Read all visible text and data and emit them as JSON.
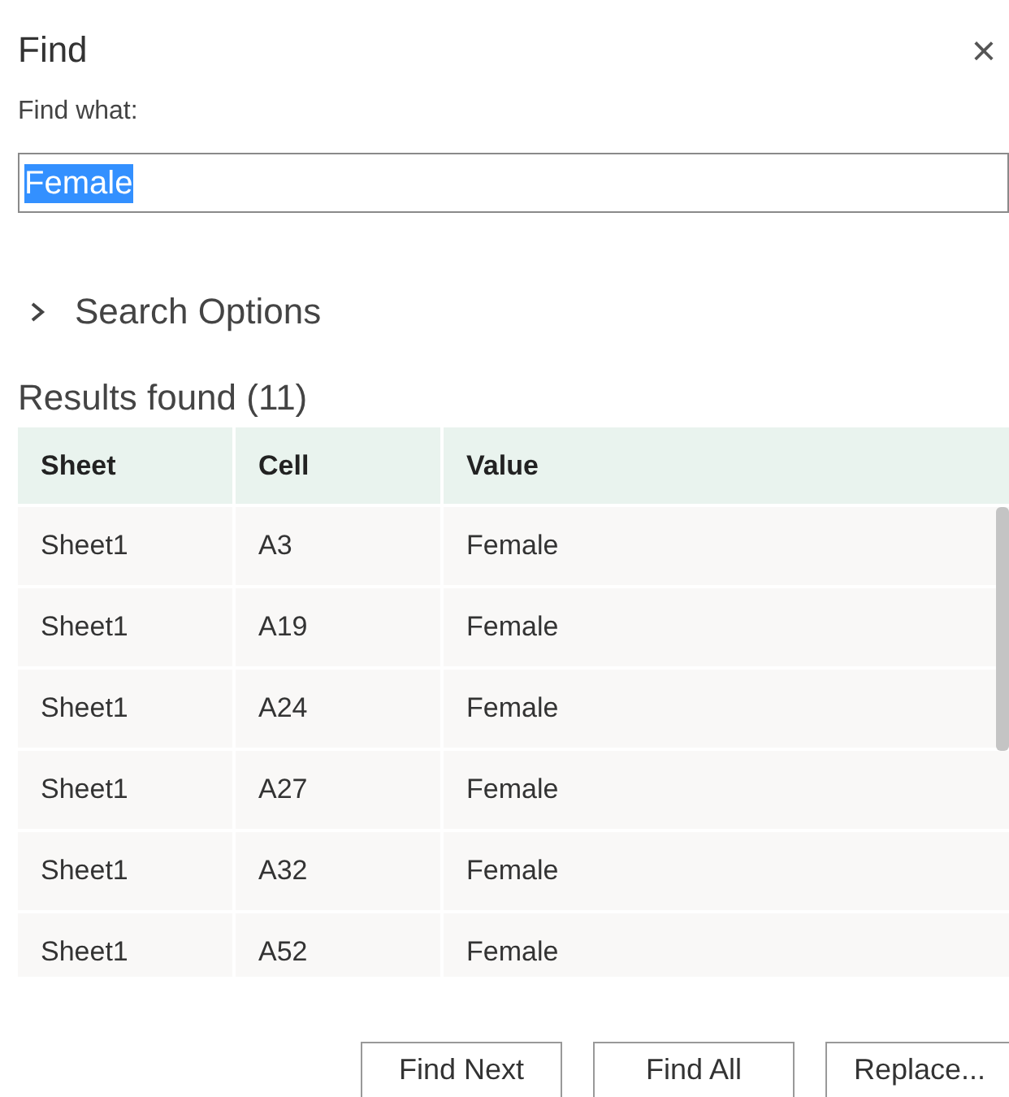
{
  "dialog": {
    "title": "Find",
    "close": "×"
  },
  "find_what": {
    "label": "Find what:",
    "value": "Female",
    "value_selected": true
  },
  "search_options": {
    "label": "Search Options",
    "expanded": false
  },
  "results": {
    "label": "Results found (11)",
    "columns": [
      "Sheet",
      "Cell",
      "Value"
    ],
    "rows": [
      [
        "Sheet1",
        "A3",
        "Female"
      ],
      [
        "Sheet1",
        "A19",
        "Female"
      ],
      [
        "Sheet1",
        "A24",
        "Female"
      ],
      [
        "Sheet1",
        "A27",
        "Female"
      ],
      [
        "Sheet1",
        "A32",
        "Female"
      ],
      [
        "Sheet1",
        "A52",
        "Female"
      ]
    ]
  },
  "buttons": [
    "Find Next",
    "Find All",
    "Replace..."
  ]
}
